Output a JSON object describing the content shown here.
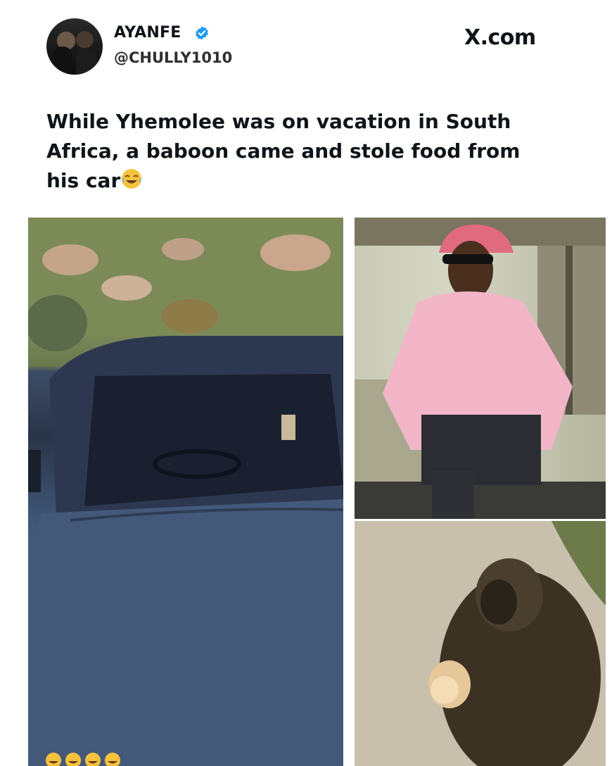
{
  "post": {
    "author_name": "AYANFE",
    "author_handle": "@CHULLY1010",
    "verified": true,
    "source_label": "X.com",
    "text": "While Yhemolee was on vacation in South Africa, a baboon came and stole food from his car",
    "text_emoji": "face-with-tears-of-joy",
    "caption_emojis": [
      "rolling-on-floor-laughing",
      "rolling-on-floor-laughing",
      "rolling-on-floor-laughing",
      "rolling-on-floor-laughing"
    ]
  },
  "colors": {
    "verified_blue": "#1d9bf0",
    "text": "#0f1419"
  }
}
